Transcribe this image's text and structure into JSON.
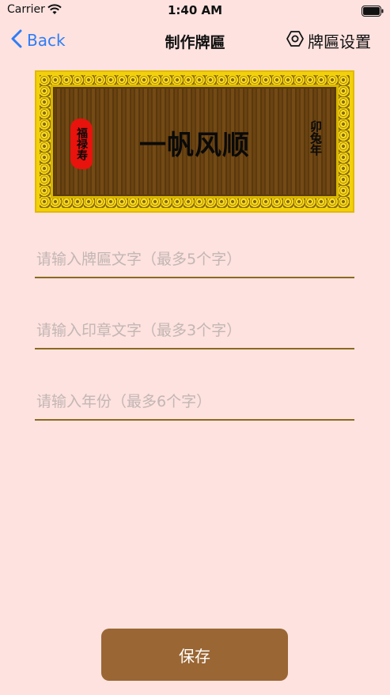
{
  "status_bar": {
    "carrier": "Carrier",
    "time": "1:40 AM"
  },
  "nav": {
    "back_label": "Back",
    "title": "制作牌匾",
    "settings_label": "牌匾设置"
  },
  "plaque": {
    "main_text": "一帆风顺",
    "seal_text": "福禄寿",
    "year_text": "卯兔年"
  },
  "form": {
    "plaque_text": {
      "value": "",
      "placeholder": "请输入牌匾文字（最多5个字）"
    },
    "seal_text": {
      "value": "",
      "placeholder": "请输入印章文字（最多3个字）"
    },
    "year": {
      "value": "",
      "placeholder": "请输入年份（最多6个字）"
    }
  },
  "save_label": "保存",
  "colors": {
    "background": "#FDE2DF",
    "accent": "#2F7CF6",
    "button": "#9A6633",
    "underline": "#8C6A1F",
    "seal": "#E8130C"
  }
}
